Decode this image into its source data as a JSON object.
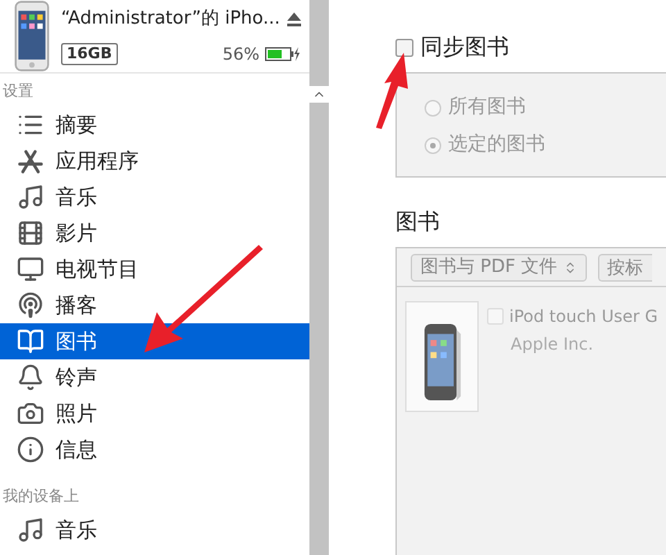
{
  "device": {
    "name": "“Administrator”的 iPho...",
    "capacity": "16GB",
    "battery": "56%"
  },
  "sidebar": {
    "sections": [
      {
        "title": "设置",
        "items": [
          {
            "label": "摘要",
            "kind": "summary",
            "selected": false
          },
          {
            "label": "应用程序",
            "kind": "apps",
            "selected": false
          },
          {
            "label": "音乐",
            "kind": "music",
            "selected": false
          },
          {
            "label": "影片",
            "kind": "movies",
            "selected": false
          },
          {
            "label": "电视节目",
            "kind": "tv",
            "selected": false
          },
          {
            "label": "播客",
            "kind": "podcasts",
            "selected": false
          },
          {
            "label": "图书",
            "kind": "books",
            "selected": true
          },
          {
            "label": "铃声",
            "kind": "tones",
            "selected": false
          },
          {
            "label": "照片",
            "kind": "photos",
            "selected": false
          },
          {
            "label": "信息",
            "kind": "info",
            "selected": false
          }
        ]
      },
      {
        "title": "我的设备上",
        "items": [
          {
            "label": "音乐",
            "kind": "music",
            "selected": false
          }
        ]
      }
    ]
  },
  "sync": {
    "label": "同步图书",
    "checked": false,
    "options": [
      {
        "label": "所有图书",
        "selected": false
      },
      {
        "label": "选定的图书",
        "selected": true
      }
    ]
  },
  "books": {
    "title": "图书",
    "filter": "图书与 PDF 文件",
    "sort": "按标",
    "items": [
      {
        "title": "iPod touch User G",
        "author": "Apple Inc.",
        "checked": false,
        "kind": "picture"
      }
    ]
  }
}
